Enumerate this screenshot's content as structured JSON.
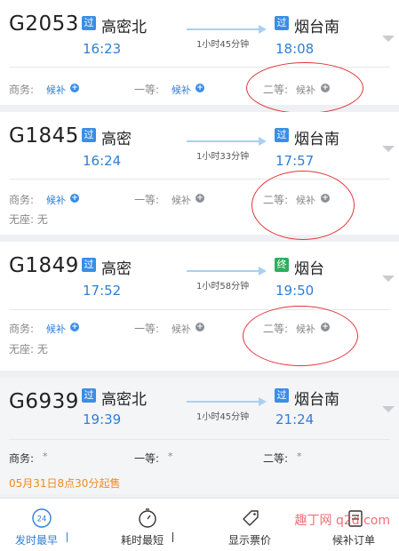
{
  "trains": [
    {
      "number": "G2053",
      "from_badge": "过",
      "from": "高密北",
      "depart": "16:23",
      "duration": "1小时45分钟",
      "to_badge": "过",
      "to": "烟台南",
      "arrive": "18:08",
      "business_label": "商务:",
      "business_status": "候补",
      "first_label": "一等:",
      "first_status": "候补",
      "second_label": "二等:",
      "second_status": "候补"
    },
    {
      "number": "G1845",
      "from_badge": "过",
      "from": "高密",
      "depart": "16:24",
      "duration": "1小时33分钟",
      "to_badge": "过",
      "to": "烟台南",
      "arrive": "17:57",
      "business_label": "商务:",
      "business_status": "候补",
      "first_label": "一等:",
      "first_status": "候补",
      "second_label": "二等:",
      "second_status": "候补",
      "standing": "无座: 无"
    },
    {
      "number": "G1849",
      "from_badge": "过",
      "from": "高密",
      "depart": "17:52",
      "duration": "1小时58分钟",
      "to_badge": "终",
      "to": "烟台",
      "arrive": "19:50",
      "business_label": "商务:",
      "business_status": "候补",
      "first_label": "一等:",
      "first_status": "候补",
      "second_label": "二等:",
      "second_status": "候补",
      "standing": "无座: 无"
    },
    {
      "number": "G6939",
      "from_badge": "过",
      "from": "高密北",
      "depart": "19:39",
      "duration": "1小时45分钟",
      "to_badge": "过",
      "to": "烟台南",
      "arrive": "21:24",
      "business_label": "商务:",
      "business_status": "*",
      "first_label": "一等:",
      "first_status": "*",
      "second_label": "二等:",
      "second_status": "*",
      "sale_note": "05月31日8点30分起售"
    }
  ],
  "nav": {
    "depart_earliest": "发时最早",
    "depart_icon_text": "24",
    "shortest_duration": "耗时最短",
    "show_price": "显示票价",
    "waitlist": "候补订单"
  },
  "watermark": "趣丁网 q2d.com",
  "colors": {
    "accent": "#2e7fd6",
    "circle": "#e3343b",
    "sale": "#f08a1c"
  }
}
